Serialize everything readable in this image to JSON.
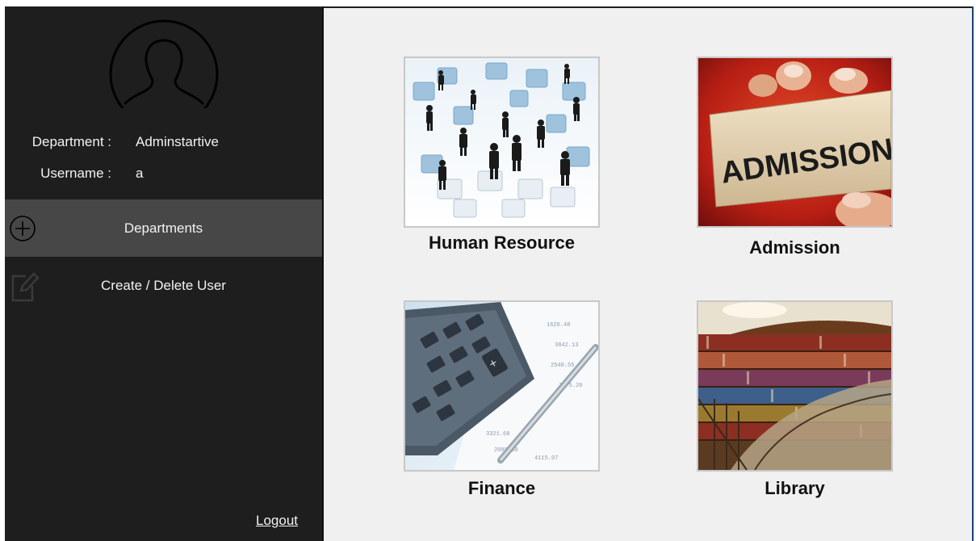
{
  "user": {
    "department_label": "Department :",
    "department_value": "Adminstartive",
    "username_label": "Username :",
    "username_value": "a"
  },
  "nav": {
    "items": [
      {
        "label": "Departments",
        "icon": "plus-circle-icon",
        "active": true
      },
      {
        "label": "Create / Delete User",
        "icon": "edit-icon",
        "active": false
      }
    ],
    "logout": "Logout"
  },
  "departments": [
    {
      "label": "Human Resource",
      "image": "puzzle-business-people"
    },
    {
      "label": "Admission",
      "image": "admission-card"
    },
    {
      "label": "Finance",
      "image": "calculator-pen"
    },
    {
      "label": "Library",
      "image": "bookshelves"
    }
  ],
  "colors": {
    "sidebar": "#1e1e1e",
    "active_item": "#474747",
    "content": "#f0f0f0"
  }
}
